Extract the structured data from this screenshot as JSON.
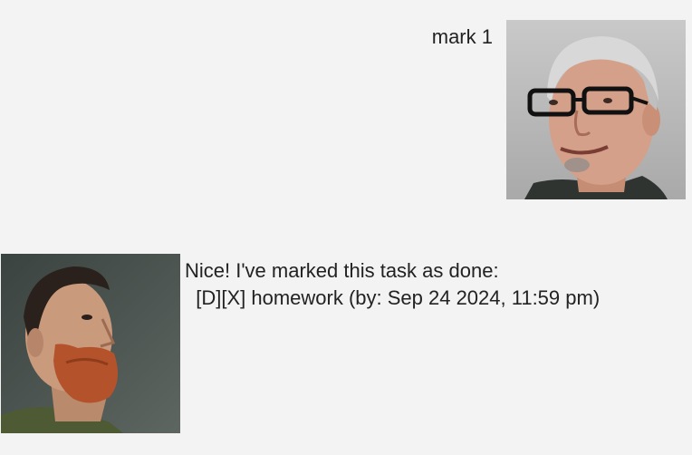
{
  "user_message": {
    "text": "mark 1",
    "avatar_icon": "user-portrait-glasses"
  },
  "bot_message": {
    "text": "Nice! I've marked this task as done:\n  [D][X] homework (by: Sep 24 2024, 11:59 pm)",
    "avatar_icon": "bot-portrait-beard"
  }
}
